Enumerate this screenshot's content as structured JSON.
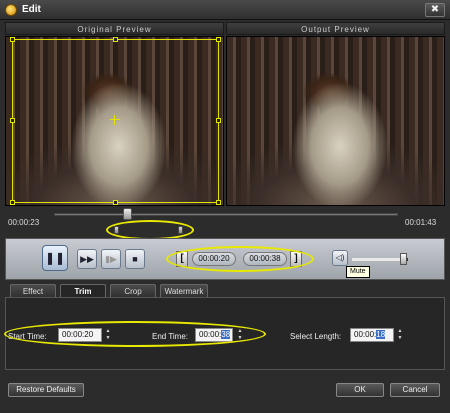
{
  "window": {
    "title": "Edit",
    "close_glyph": "✖"
  },
  "preview": {
    "original_label": "Original Preview",
    "output_label": "Output Preview"
  },
  "timeline": {
    "current_time": "00:00:23",
    "total_time": "00:01:43",
    "position_fraction": 0.22
  },
  "controls": {
    "pause_glyph": "❚❚",
    "fast_forward_glyph": "▶▶",
    "step_glyph": "▮▶",
    "stop_glyph": "■",
    "start_bracket": "[",
    "end_bracket": "]",
    "trim_start": "00:00:20",
    "trim_end": "00:00:38",
    "volume_glyph": "◁)",
    "volume_level": 0.9,
    "mute_tooltip": "Mute"
  },
  "tabs": [
    {
      "label": "Effect",
      "active": false
    },
    {
      "label": "Trim",
      "active": true
    },
    {
      "label": "Crop",
      "active": false
    },
    {
      "label": "Watermark",
      "active": false
    }
  ],
  "trim": {
    "start_label": "Start Time:",
    "start_value": "00:00:20",
    "end_label": "End Time:",
    "end_value_prefix": "00:00:",
    "end_value_selected": "38",
    "length_label": "Select Length:",
    "length_value_prefix": "00:00:",
    "length_value_selected": "18"
  },
  "buttons": {
    "restore": "Restore Defaults",
    "ok": "OK",
    "cancel": "Cancel"
  },
  "colors": {
    "highlight_ellipse": "#e8e800",
    "selection": "#3a6ec4"
  }
}
